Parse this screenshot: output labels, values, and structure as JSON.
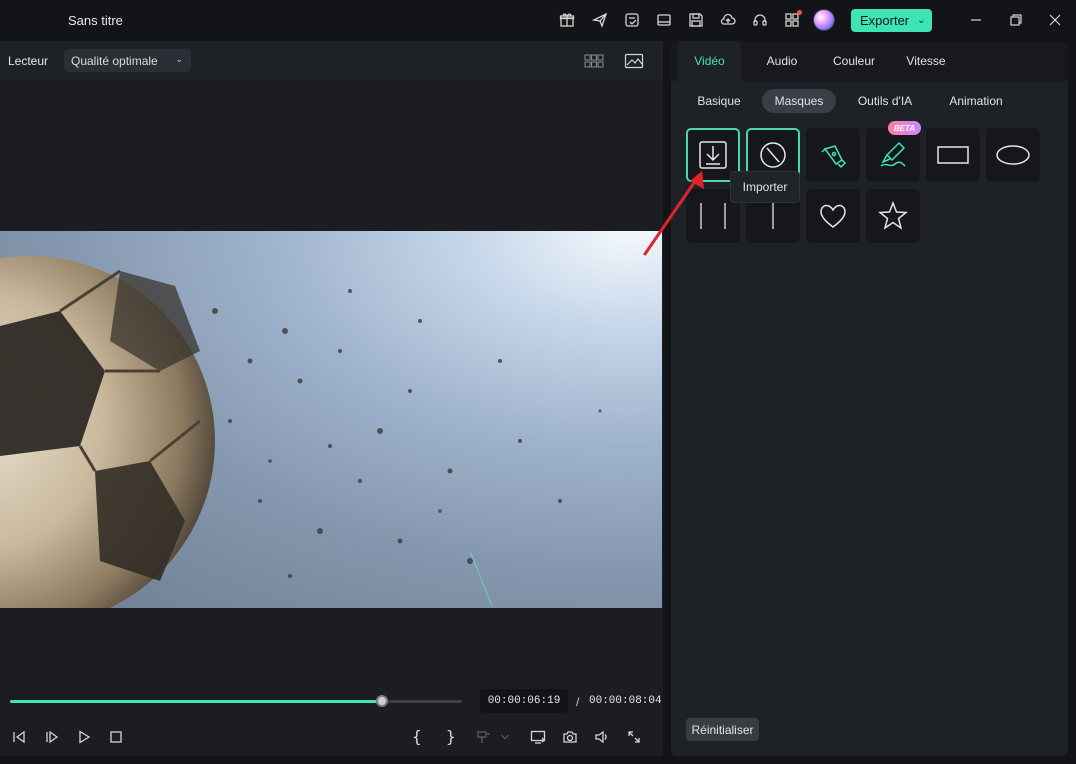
{
  "titlebar": {
    "app_title": "Sans titre",
    "export_label": "Exporter",
    "icons": [
      "gift-icon",
      "send-icon",
      "checklist-icon",
      "layout-icon",
      "save-icon",
      "cloud-upload-icon",
      "headset-icon",
      "apps-grid-icon",
      "ai-avatar-icon"
    ],
    "window_controls": [
      "minimize-icon",
      "restore-icon",
      "close-icon"
    ]
  },
  "player": {
    "label": "Lecteur",
    "quality": "Qualité optimale",
    "current_time": "00:00:06:19",
    "separator": "/",
    "total_time": "00:00:08:04",
    "progress_fraction": 0.823,
    "mark_in": "{",
    "mark_out": "}"
  },
  "panel": {
    "main_tabs": [
      {
        "label": "Vidéo",
        "active": true
      },
      {
        "label": "Audio",
        "active": false
      },
      {
        "label": "Couleur",
        "active": false
      },
      {
        "label": "Vitesse",
        "active": false
      }
    ],
    "sub_tabs": [
      {
        "label": "Basique",
        "active": false
      },
      {
        "label": "Masques",
        "active": true
      },
      {
        "label": "Outils d'IA",
        "active": false
      },
      {
        "label": "Animation",
        "active": false
      }
    ],
    "masks": [
      "import-mask-icon",
      "no-mask-icon",
      "pen-mask-icon",
      "brush-mask-icon",
      "rectangle-mask-icon",
      "ellipse-mask-icon",
      "double-line-mask-icon",
      "single-line-mask-icon",
      "heart-mask-icon",
      "star-mask-icon"
    ],
    "beta_label": "BETA",
    "tooltip": "Importer",
    "reset_label": "Réinitialiser"
  },
  "colors": {
    "accent": "#3ee4b6",
    "annotation_arrow": "#e0242b"
  }
}
